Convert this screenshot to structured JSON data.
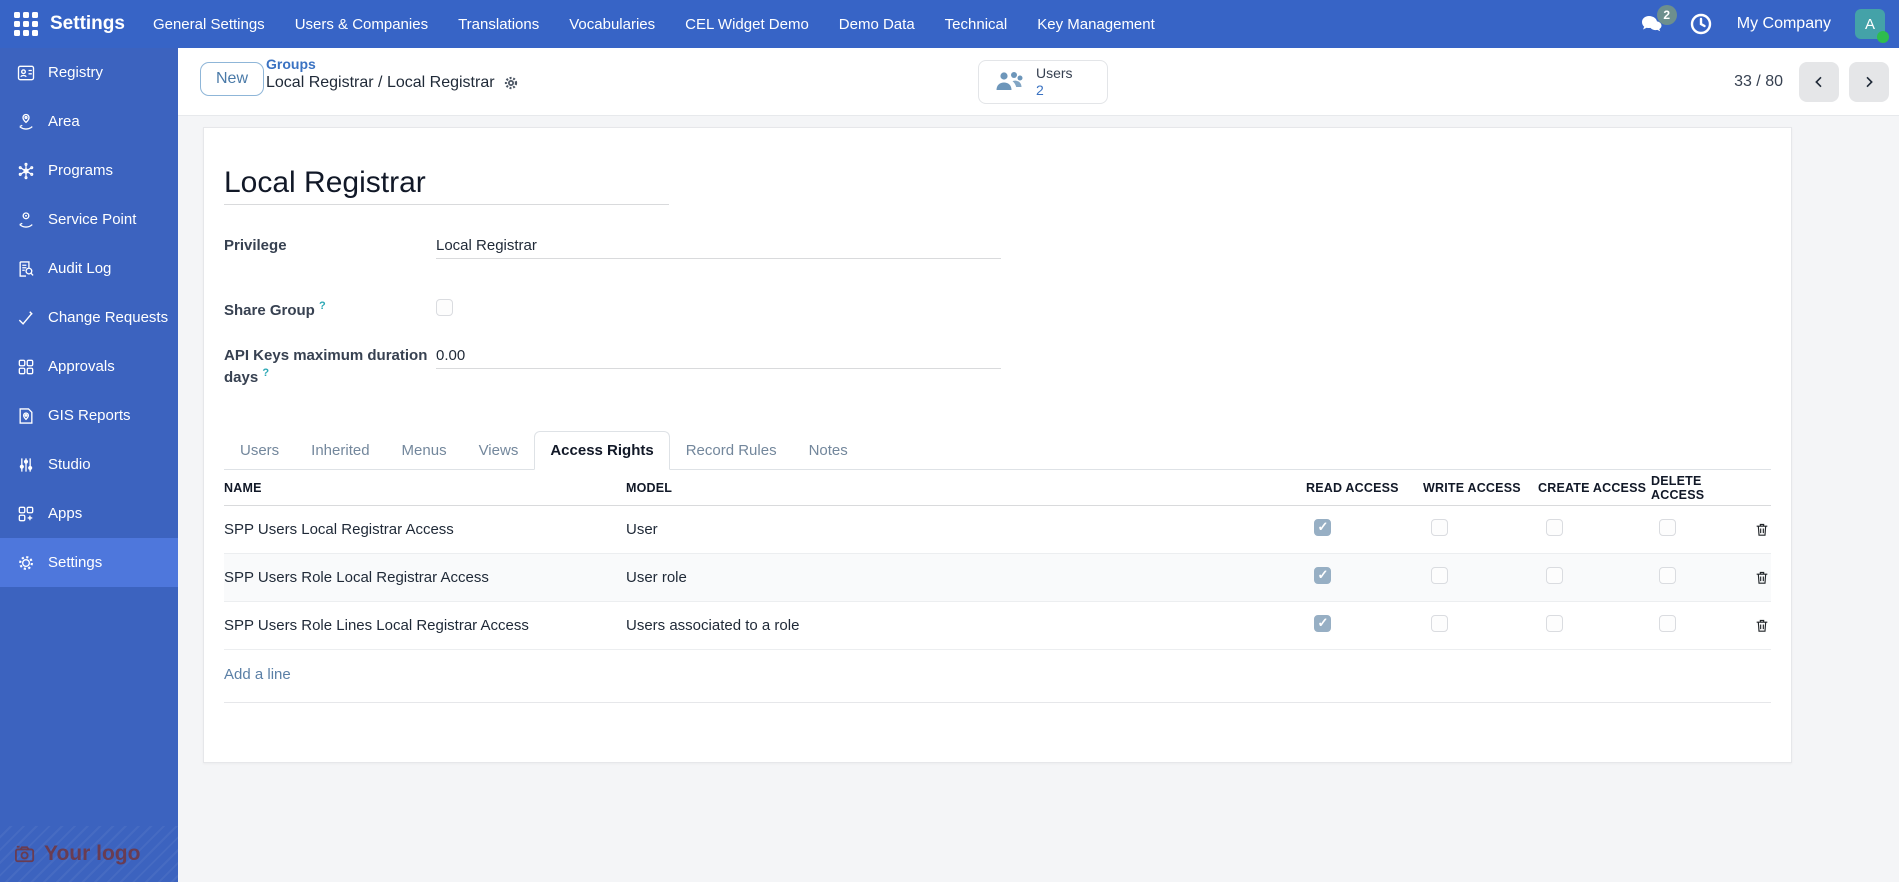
{
  "navbar": {
    "app_name": "Settings",
    "menu_items": [
      "General Settings",
      "Users & Companies",
      "Translations",
      "Vocabularies",
      "CEL Widget Demo",
      "Demo Data",
      "Technical",
      "Key Management"
    ],
    "chat_badge": "2",
    "company": "My Company",
    "avatar_initial": "A"
  },
  "sidebar": {
    "items": [
      {
        "label": "Registry",
        "icon": "id-card",
        "active": false
      },
      {
        "label": "Area",
        "icon": "hand-pin",
        "active": false
      },
      {
        "label": "Programs",
        "icon": "snowflake",
        "active": false
      },
      {
        "label": "Service Point",
        "icon": "hand-coin",
        "active": false
      },
      {
        "label": "Audit Log",
        "icon": "doc-magnifier",
        "active": false
      },
      {
        "label": "Change Requests",
        "icon": "check-pen",
        "active": false
      },
      {
        "label": "Approvals",
        "icon": "grid-blocks",
        "active": false
      },
      {
        "label": "GIS Reports",
        "icon": "map-doc",
        "active": false
      },
      {
        "label": "Studio",
        "icon": "sliders",
        "active": false
      },
      {
        "label": "Apps",
        "icon": "grid-plus",
        "active": false
      },
      {
        "label": "Settings",
        "icon": "gear",
        "active": true
      }
    ],
    "logo_text": "Your logo"
  },
  "control_panel": {
    "new_button": "New",
    "breadcrumb_parent": "Groups",
    "breadcrumb_current": "Local Registrar / Local Registrar",
    "smart_button": {
      "label": "Users",
      "count": "2"
    },
    "pager": {
      "text": "33 / 80"
    }
  },
  "form": {
    "title": "Local Registrar",
    "fields": {
      "privilege": {
        "label": "Privilege",
        "value": "Local Registrar"
      },
      "share_group": {
        "label": "Share Group",
        "help": "?",
        "checked": false
      },
      "api_keys": {
        "label": "API Keys maximum duration days",
        "help": "?",
        "value": "0.00"
      }
    },
    "tabs": [
      {
        "label": "Users",
        "active": false
      },
      {
        "label": "Inherited",
        "active": false
      },
      {
        "label": "Menus",
        "active": false
      },
      {
        "label": "Views",
        "active": false
      },
      {
        "label": "Access Rights",
        "active": true
      },
      {
        "label": "Record Rules",
        "active": false
      },
      {
        "label": "Notes",
        "active": false
      }
    ],
    "table": {
      "headers": [
        "NAME",
        "MODEL",
        "READ ACCESS",
        "WRITE ACCESS",
        "CREATE ACCESS",
        "DELETE ACCESS"
      ],
      "rows": [
        {
          "name": "SPP Users Local Registrar Access",
          "model": "User",
          "read": true,
          "write": false,
          "create": false,
          "delete": false
        },
        {
          "name": "SPP Users Role Local Registrar Access",
          "model": "User role",
          "read": true,
          "write": false,
          "create": false,
          "delete": false
        },
        {
          "name": "SPP Users Role Lines Local Registrar Access",
          "model": "Users associated to a role",
          "read": true,
          "write": false,
          "create": false,
          "delete": false
        }
      ],
      "add_line": "Add a line"
    }
  },
  "colors": {
    "navbar": "#3764c6",
    "sidebar": "#3c63bf",
    "sidebar_active": "#4e77dc",
    "link": "#3a72c2",
    "checked_checkbox": "#97afc4",
    "help": "#2ca8b5",
    "avatar": "#44a2a8",
    "badge": "#6d8f8e"
  }
}
